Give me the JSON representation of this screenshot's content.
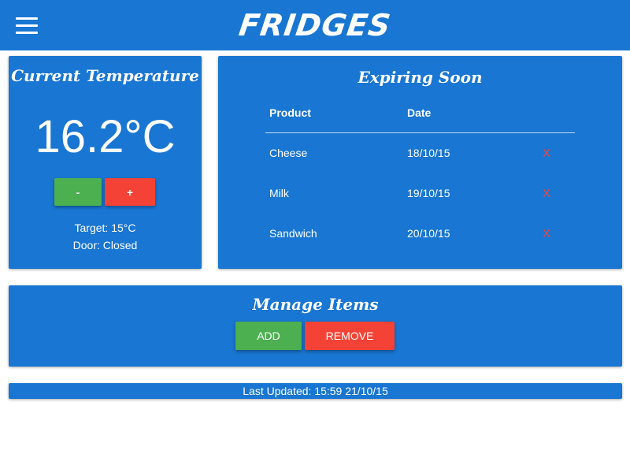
{
  "header": {
    "title": "FRIDGES",
    "menu_icon": "hamburger-menu-icon"
  },
  "temperature": {
    "title": "Current Temperature",
    "current": "16.2°C",
    "decrease_label": "-",
    "increase_label": "+",
    "target": "Target: 15°C",
    "door": "Door: Closed"
  },
  "expiring": {
    "title": "Expiring Soon",
    "columns": [
      "Product",
      "Date"
    ],
    "rows": [
      {
        "product": "Cheese",
        "date": "18/10/15",
        "remove": "X"
      },
      {
        "product": "Milk",
        "date": "19/10/15",
        "remove": "X"
      },
      {
        "product": "Sandwich",
        "date": "20/10/15",
        "remove": "X"
      }
    ]
  },
  "manage": {
    "title": "Manage Items",
    "add_label": "ADD",
    "remove_label": "REMOVE"
  },
  "status": {
    "last_updated": "Last Updated: 15:59 21/10/15"
  },
  "colors": {
    "primary": "#1976d2",
    "green": "#4caf50",
    "red": "#f44336"
  }
}
